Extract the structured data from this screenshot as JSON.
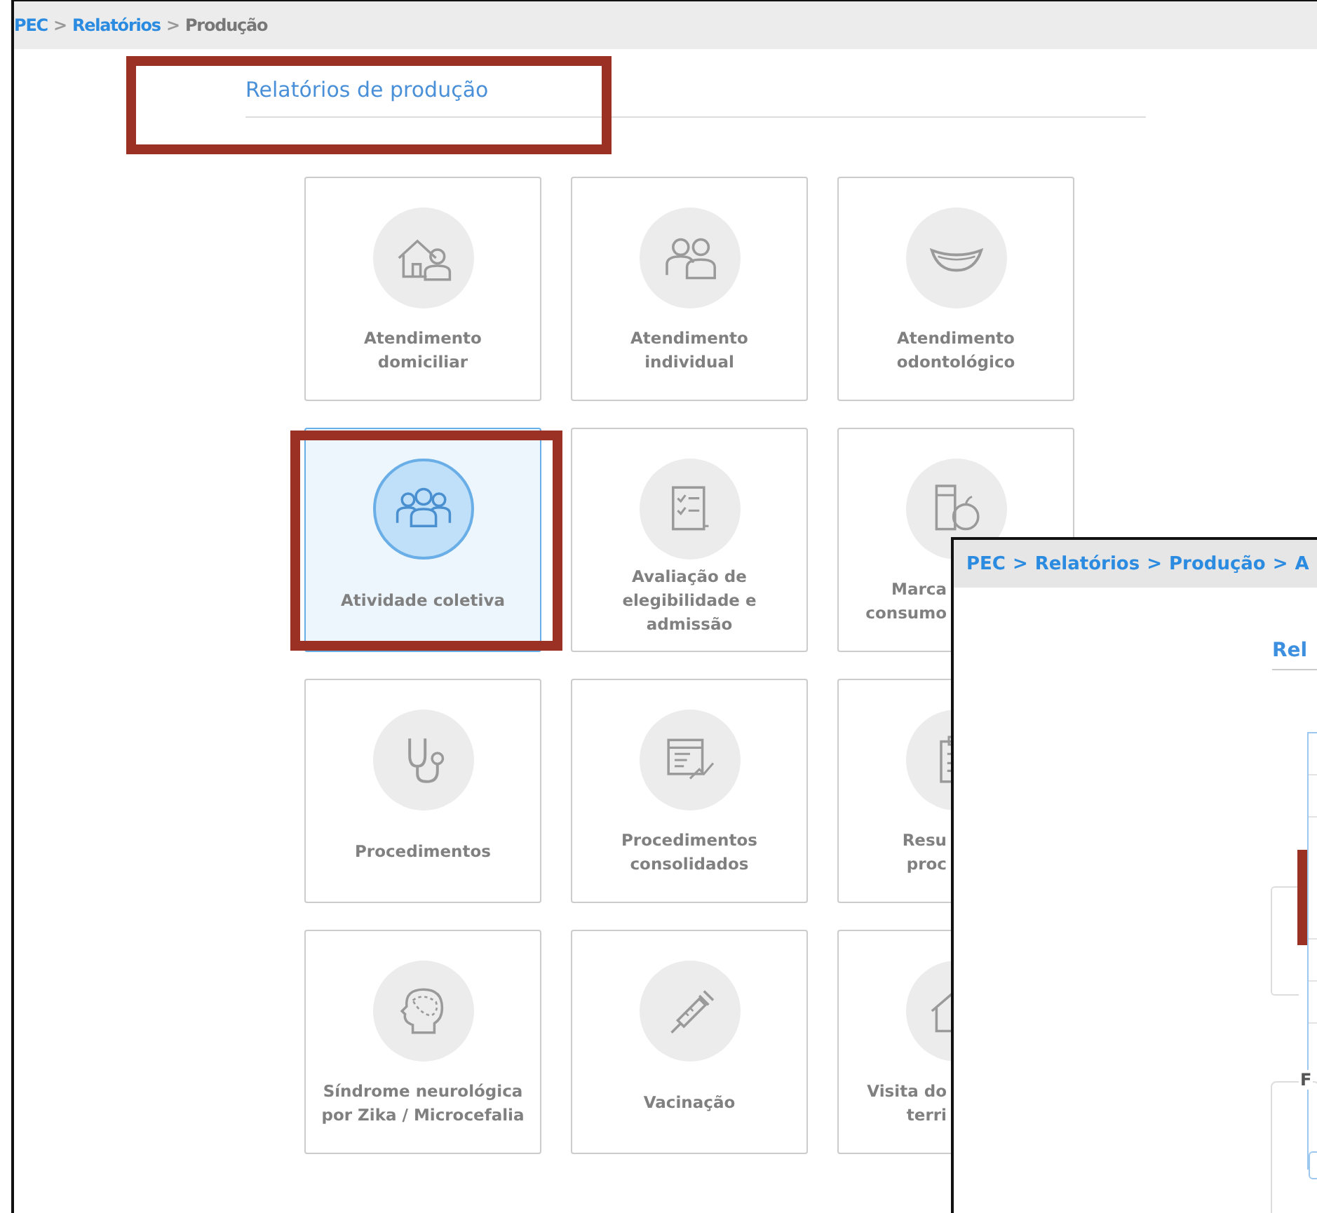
{
  "breadcrumb": {
    "separator": ">",
    "items": [
      {
        "label": "PEC",
        "link": true
      },
      {
        "label": "Relatórios",
        "link": true
      },
      {
        "label": "Produção",
        "link": false
      }
    ]
  },
  "heading": "Relatórios de produção",
  "tiles": [
    {
      "label": "Atendimento domiciliar",
      "selected": false,
      "cut_off": false
    },
    {
      "label": "Atendimento individual",
      "selected": false,
      "cut_off": false
    },
    {
      "label": "Atendimento odontológico",
      "selected": false,
      "cut_off": false
    },
    {
      "label": "Atividade coletiva",
      "selected": true,
      "cut_off": false
    },
    {
      "label": "Avaliação de elegibilidade e admissão",
      "selected": false,
      "cut_off": false
    },
    {
      "label": "Marca\nconsumo",
      "selected": false,
      "cut_off": true
    },
    {
      "label": "Procedimentos",
      "selected": false,
      "cut_off": false
    },
    {
      "label": "Procedimentos consolidados",
      "selected": false,
      "cut_off": false
    },
    {
      "label": "Resu\nproc",
      "selected": false,
      "cut_off": true
    },
    {
      "label": "Síndrome neurológica por Zika / Microcefalia",
      "selected": false,
      "cut_off": false
    },
    {
      "label": "Vacinação",
      "selected": false,
      "cut_off": false
    },
    {
      "label": "Visita do\nterri",
      "selected": false,
      "cut_off": true
    }
  ],
  "overlay_window": {
    "breadcrumb": {
      "separator": ">",
      "items": [
        {
          "label": "PEC",
          "link": true
        },
        {
          "label": "Relatórios",
          "link": true
        },
        {
          "label": "Produção",
          "link": true
        },
        {
          "label": "A",
          "link": true
        }
      ]
    },
    "heading": "Rel",
    "fieldset_legend": "F"
  }
}
